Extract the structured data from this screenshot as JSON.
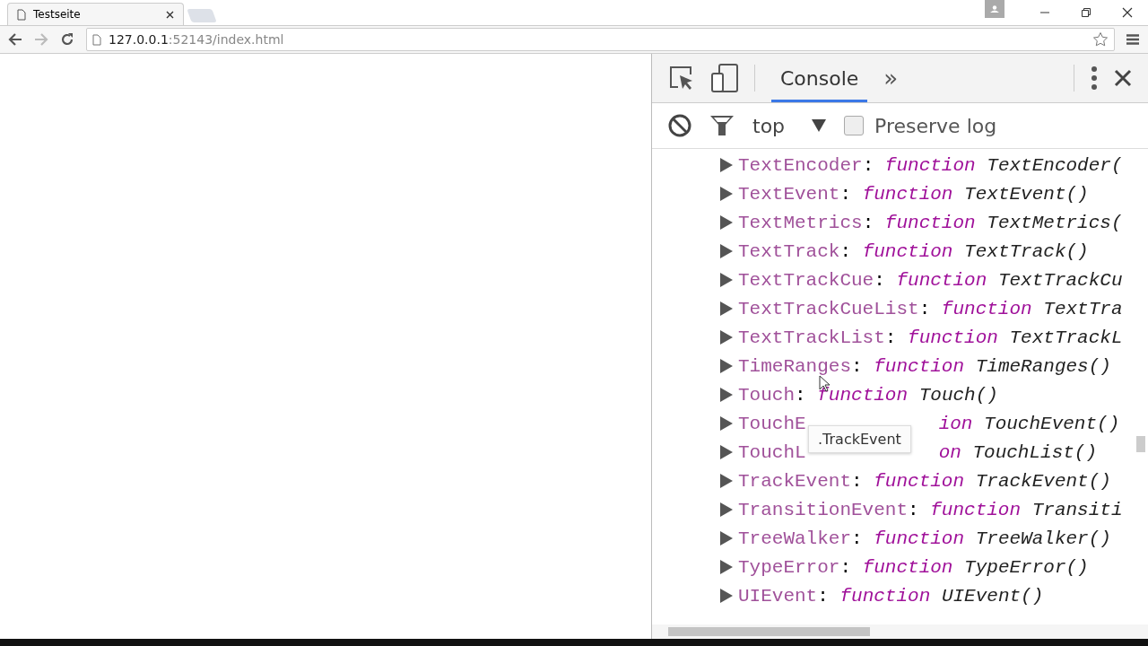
{
  "browser": {
    "tab": {
      "title": "Testseite"
    },
    "address": {
      "host": "127.0.0.1",
      "path": ":52143/index.html"
    }
  },
  "devtools": {
    "tabs": [
      {
        "label": "Console",
        "selected": true
      }
    ],
    "more": "»",
    "context": "top",
    "preserve_log": {
      "label": "Preserve log",
      "checked": false
    },
    "rows": [
      {
        "kind": "full",
        "name": "TextEncoder",
        "colon": ":",
        "keyword": "function",
        "signature": "TextEncoder("
      },
      {
        "kind": "full",
        "name": "TextEvent",
        "colon": ":",
        "keyword": "function",
        "signature": "TextEvent()"
      },
      {
        "kind": "full",
        "name": "TextMetrics",
        "colon": ":",
        "keyword": "function",
        "signature": "TextMetrics("
      },
      {
        "kind": "full",
        "name": "TextTrack",
        "colon": ":",
        "keyword": "function",
        "signature": "TextTrack()"
      },
      {
        "kind": "full",
        "name": "TextTrackCue",
        "colon": ":",
        "keyword": "function",
        "signature": "TextTrackCu"
      },
      {
        "kind": "full",
        "name": "TextTrackCueList",
        "colon": ":",
        "keyword": "function",
        "signature": "TextTra"
      },
      {
        "kind": "full",
        "name": "TextTrackList",
        "colon": ":",
        "keyword": "function",
        "signature": "TextTrackL"
      },
      {
        "kind": "full",
        "name": "TimeRanges",
        "colon": ":",
        "keyword": "function",
        "signature": "TimeRanges()"
      },
      {
        "kind": "full",
        "name": "Touch",
        "colon": ":",
        "keyword": "function",
        "signature": "Touch()"
      },
      {
        "kind": "covered",
        "name": "TouchE",
        "keyword": "ion",
        "signature": "TouchEvent()"
      },
      {
        "kind": "covered",
        "name": "TouchL",
        "keyword": "on",
        "signature": "TouchList()"
      },
      {
        "kind": "full",
        "name": "TrackEvent",
        "colon": ":",
        "keyword": "function",
        "signature": "TrackEvent()"
      },
      {
        "kind": "full",
        "name": "TransitionEvent",
        "colon": ":",
        "keyword": "function",
        "signature": "Transiti"
      },
      {
        "kind": "full",
        "name": "TreeWalker",
        "colon": ":",
        "keyword": "function",
        "signature": "TreeWalker()"
      },
      {
        "kind": "full",
        "name": "TypeError",
        "colon": ":",
        "keyword": "function",
        "signature": "TypeError()"
      },
      {
        "kind": "full",
        "name": "UIEvent",
        "colon": ":",
        "keyword": "function",
        "signature": "UIEvent()"
      }
    ],
    "tooltip": ".TrackEvent"
  }
}
